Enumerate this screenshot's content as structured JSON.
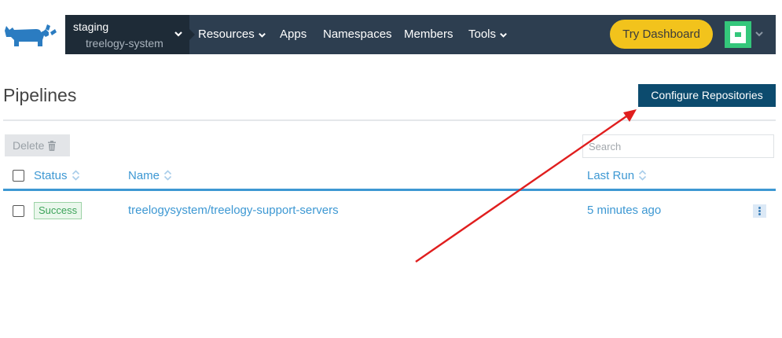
{
  "colors": {
    "nav_bg": "#2d3e50",
    "cluster_bg": "#1e2b37",
    "accent_yellow": "#f2c31c",
    "primary_btn": "#0c4b6e",
    "link_blue": "#3d98d3",
    "success_green": "#3da35a",
    "annotation_red": "#e01e1e"
  },
  "header": {
    "logo_icon": "rancher-cow-logo",
    "cluster": {
      "name": "staging",
      "project": "treelogy-system"
    },
    "nav": [
      {
        "label": "Resources",
        "has_dropdown": true
      },
      {
        "label": "Apps",
        "has_dropdown": false
      },
      {
        "label": "Namespaces",
        "has_dropdown": false
      },
      {
        "label": "Members",
        "has_dropdown": false
      },
      {
        "label": "Tools",
        "has_dropdown": true
      }
    ],
    "try_dashboard": "Try Dashboard",
    "avatar_icon": "user-avatar-icon"
  },
  "page": {
    "title": "Pipelines",
    "configure_button": "Configure Repositories",
    "delete_button": "Delete",
    "search": {
      "placeholder": "Search",
      "value": ""
    }
  },
  "table": {
    "columns": [
      "Status",
      "Name",
      "Last Run"
    ],
    "rows": [
      {
        "status": "Success",
        "name": "treelogysystem/treelogy-support-servers",
        "last_run": "5 minutes ago",
        "checked": false
      }
    ]
  },
  "annotation": {
    "type": "arrow",
    "color": "#e01e1e",
    "points_to": "configure-repositories-button"
  }
}
